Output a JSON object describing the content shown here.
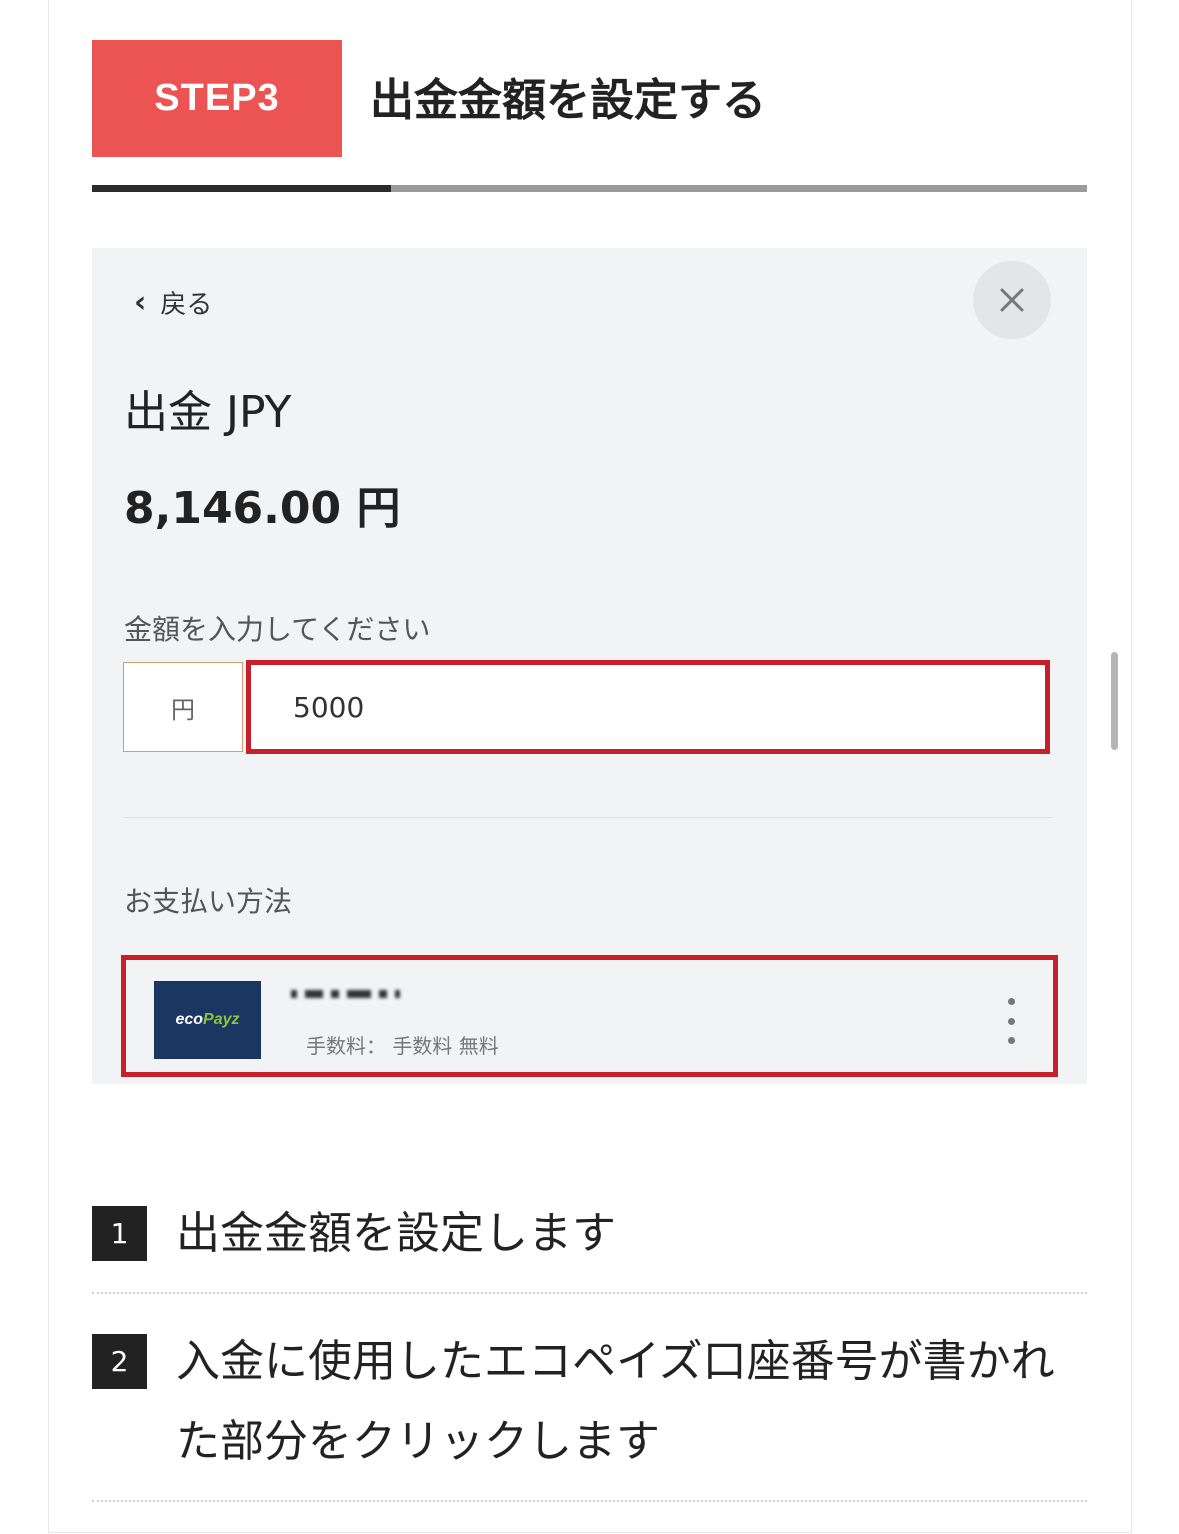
{
  "header": {
    "step_badge": "STEP3",
    "title": "出金金額を設定する",
    "progress_fraction": 0.3
  },
  "panel": {
    "back_label": "戻る",
    "close_icon": "close-icon",
    "title": "出金 JPY",
    "balance": "8,146.00 円",
    "amount_label": "金額を入力してください",
    "currency_unit": "円",
    "amount_value": "5000",
    "payment_label": "お支払い方法",
    "payment_method": {
      "logo_text_a": "eco",
      "logo_text_b": "Payz",
      "fee_text": "手数料： 手数料 無料",
      "more_icon": "vertical-dots-icon"
    }
  },
  "instructions": [
    {
      "number": "1",
      "text": "出金金額を設定します"
    },
    {
      "number": "2",
      "text": "入金に使用したエコペイズ口座番号が書かれた部分をクリックします"
    }
  ],
  "colors": {
    "badge": "#eb5453",
    "highlight_border": "#c8202b",
    "ecopayz_bg": "#1b3660",
    "ecopayz_accent": "#8fc33d"
  }
}
